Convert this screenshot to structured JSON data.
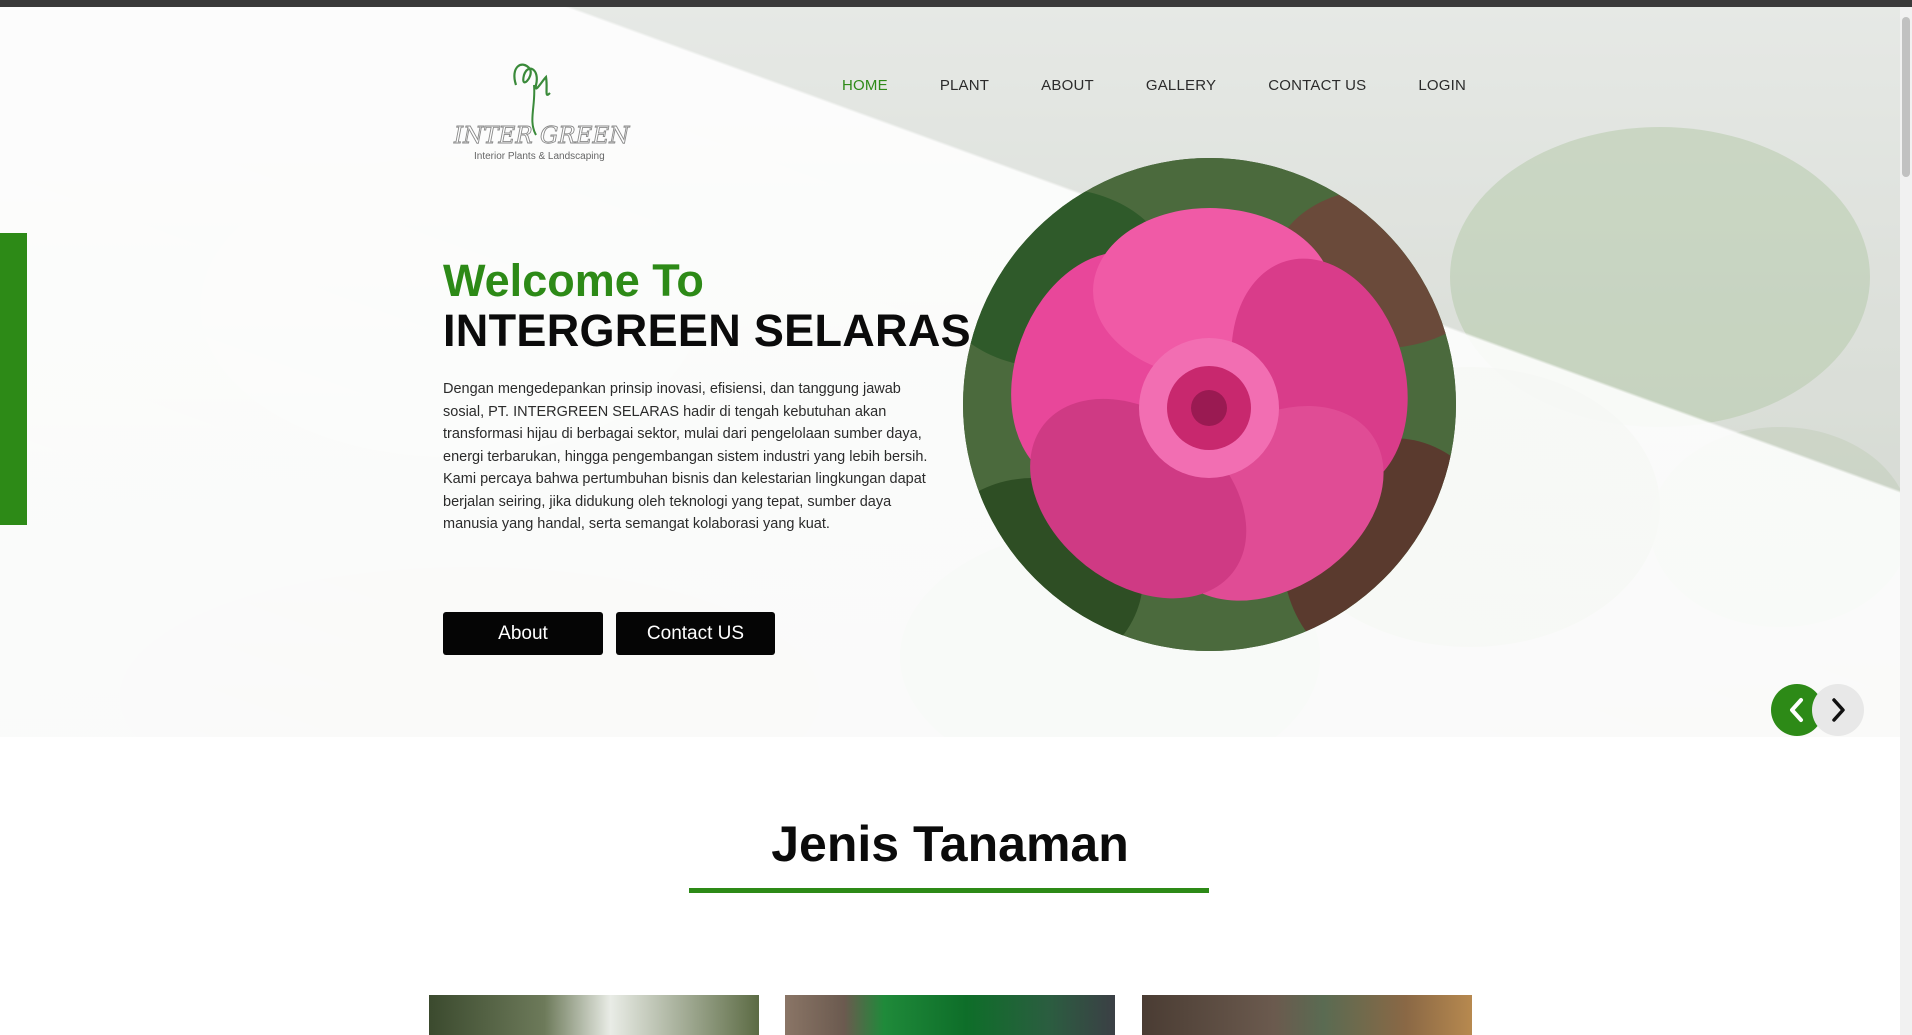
{
  "logo": {
    "brand_text": "INTER GREEN",
    "tagline": "Interior Plants & Landscaping"
  },
  "nav": {
    "items": [
      {
        "label": "HOME",
        "active": true
      },
      {
        "label": "PLANT",
        "active": false
      },
      {
        "label": "ABOUT",
        "active": false
      },
      {
        "label": "GALLERY",
        "active": false
      },
      {
        "label": "CONTACT US",
        "active": false
      },
      {
        "label": "LOGIN",
        "active": false
      }
    ]
  },
  "hero": {
    "welcome": "Welcome To",
    "company": "INTERGREEN SELARAS",
    "description": "Dengan mengedepankan prinsip inovasi, efisiensi, dan tanggung jawab sosial, PT. INTERGREEN SELARAS hadir di tengah kebutuhan akan transformasi hijau di berbagai sektor, mulai dari pengelolaan sumber daya, energi terbarukan, hingga pengembangan sistem industri yang lebih bersih. Kami percaya bahwa pertumbuhan bisnis dan kelestarian lingkungan dapat berjalan seiring, jika didukung oleh teknologi yang tepat, sumber daya manusia yang handal, serta semangat kolaborasi yang kuat.",
    "about_button": "About",
    "contact_button": "Contact US"
  },
  "section": {
    "title": "Jenis Tanaman"
  },
  "colors": {
    "accent": "#2d8a17",
    "button": "#050505",
    "text": "#0b0b0b"
  },
  "icons": {
    "prev": "chevron-left-icon",
    "next": "chevron-right-icon"
  }
}
